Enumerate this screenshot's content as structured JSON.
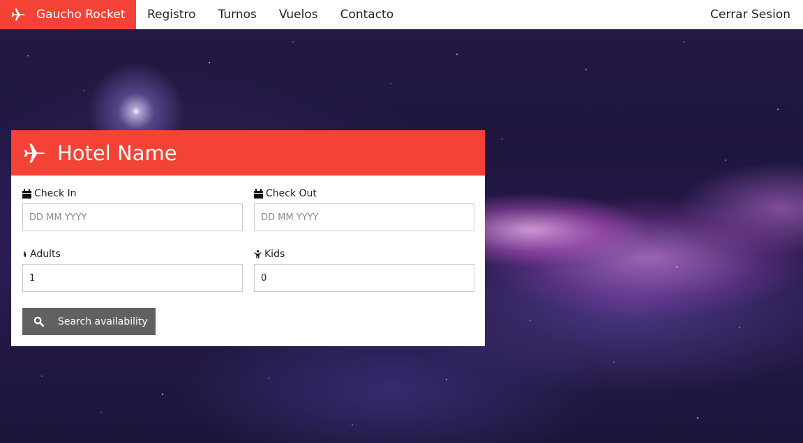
{
  "navbar": {
    "brand": "Gaucho Rocket",
    "links": [
      "Registro",
      "Turnos",
      "Vuelos",
      "Contacto"
    ],
    "logout": "Cerrar Sesion"
  },
  "card": {
    "title": "Hotel Name",
    "check_in": {
      "label": "Check In",
      "placeholder": "DD MM YYYY",
      "value": ""
    },
    "check_out": {
      "label": "Check Out",
      "placeholder": "DD MM YYYY",
      "value": ""
    },
    "adults": {
      "label": "Adults",
      "value": "1"
    },
    "kids": {
      "label": "Kids",
      "value": "0"
    },
    "search_label": "Search availability"
  },
  "colors": {
    "accent": "#f44336",
    "button": "#616161"
  },
  "icons": {
    "brand": "plane-icon",
    "header": "plane-icon",
    "check_in": "calendar-icon",
    "check_out": "calendar-icon",
    "adults": "male-icon",
    "kids": "child-icon",
    "search": "search-icon"
  }
}
